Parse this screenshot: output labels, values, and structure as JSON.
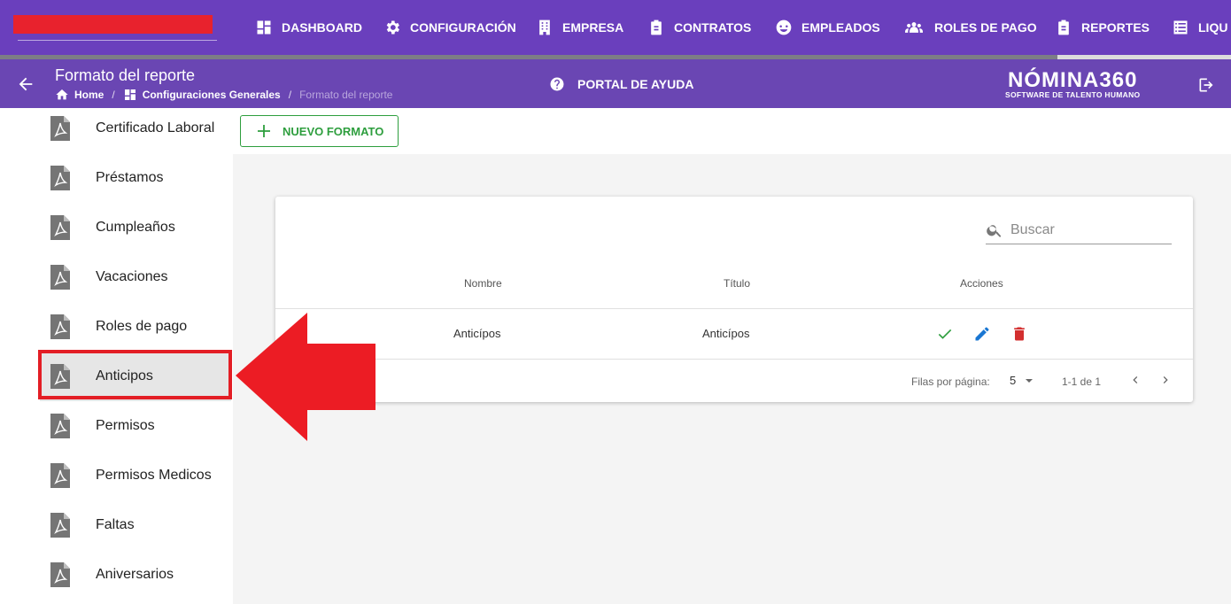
{
  "nav": {
    "items": [
      {
        "label": "DASHBOARD",
        "icon": "dashboard-icon"
      },
      {
        "label": "CONFIGURACIÓN",
        "icon": "gear-icon"
      },
      {
        "label": "EMPRESA",
        "icon": "building-icon"
      },
      {
        "label": "CONTRATOS",
        "icon": "clipboard-icon"
      },
      {
        "label": "EMPLEADOS",
        "icon": "employees-icon"
      },
      {
        "label": "ROLES DE PAGO",
        "icon": "users-icon"
      },
      {
        "label": "REPORTES",
        "icon": "clipboard-list-icon"
      },
      {
        "label": "LIQU",
        "icon": "list-icon"
      }
    ]
  },
  "header": {
    "title": "Formato del reporte",
    "breadcrumb": [
      "Home",
      "Configuraciones Generales",
      "Formato del reporte"
    ],
    "help_label": "PORTAL DE AYUDA",
    "brand_name": "NÓMINA360",
    "brand_tagline": "SOFTWARE DE TALENTO HUMANO"
  },
  "sidebar": {
    "items": [
      {
        "label": "Certificado Laboral"
      },
      {
        "label": "Préstamos"
      },
      {
        "label": "Cumpleaños"
      },
      {
        "label": "Vacaciones"
      },
      {
        "label": "Roles de pago"
      },
      {
        "label": "Anticipos"
      },
      {
        "label": "Permisos"
      },
      {
        "label": "Permisos Medicos"
      },
      {
        "label": "Faltas"
      },
      {
        "label": "Aniversarios"
      }
    ],
    "active": "Anticipos"
  },
  "toolbar": {
    "new_label": "NUEVO FORMATO"
  },
  "table": {
    "search_placeholder": "Buscar",
    "columns": [
      "Nombre",
      "Título",
      "Acciones"
    ],
    "rows": [
      {
        "nombre": "Anticípos",
        "titulo": "Anticípos"
      }
    ],
    "pagination": {
      "rows_label": "Filas por página:",
      "rows_per_page": "5",
      "range": "1-1 de 1"
    }
  },
  "colors": {
    "nav_bg": "#6a3fbd",
    "accent_green": "#2e9e3e",
    "edit_blue": "#1976d2",
    "delete_red": "#d32f2f",
    "annotation_red": "#e31e25"
  }
}
